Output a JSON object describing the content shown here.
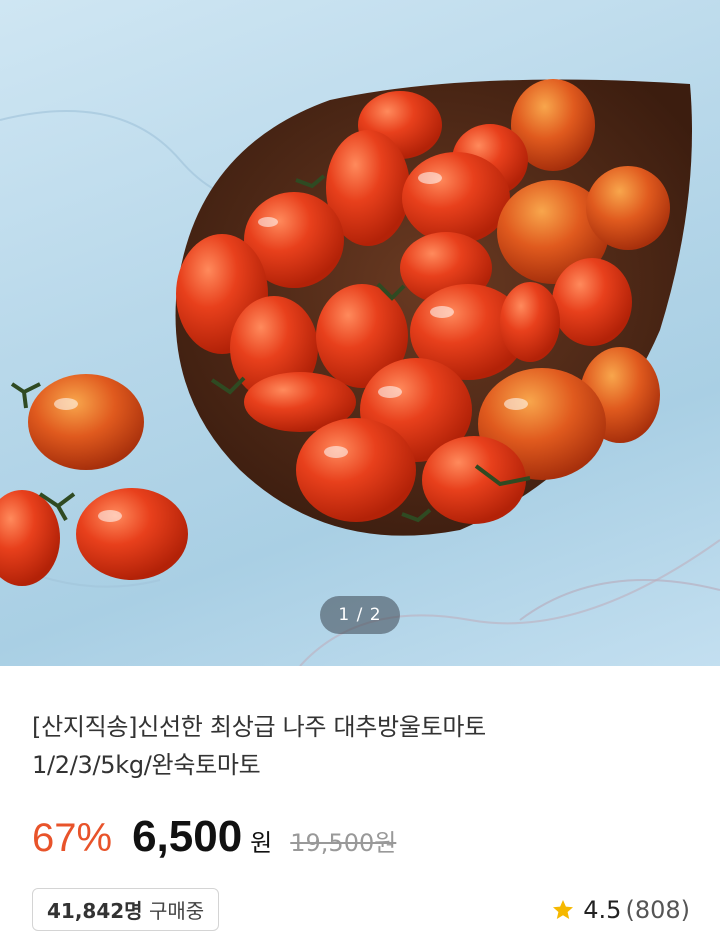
{
  "gallery": {
    "indicator": "1 / 2"
  },
  "product": {
    "title_line1": "[산지직송]신선한 최상급 나주 대추방울토마토",
    "title_line2": "1/2/3/5kg/완숙토마토",
    "discount": "67%",
    "price": "6,500",
    "price_unit": "원",
    "original_price": "19,500원",
    "buyers_count": "41,842명",
    "buyers_label": "구매중",
    "rating": "4.5",
    "review_count": "(808)"
  },
  "colors": {
    "discount": "#e8532a",
    "star": "#f5b800"
  },
  "icons": {
    "rating": "star-icon"
  }
}
